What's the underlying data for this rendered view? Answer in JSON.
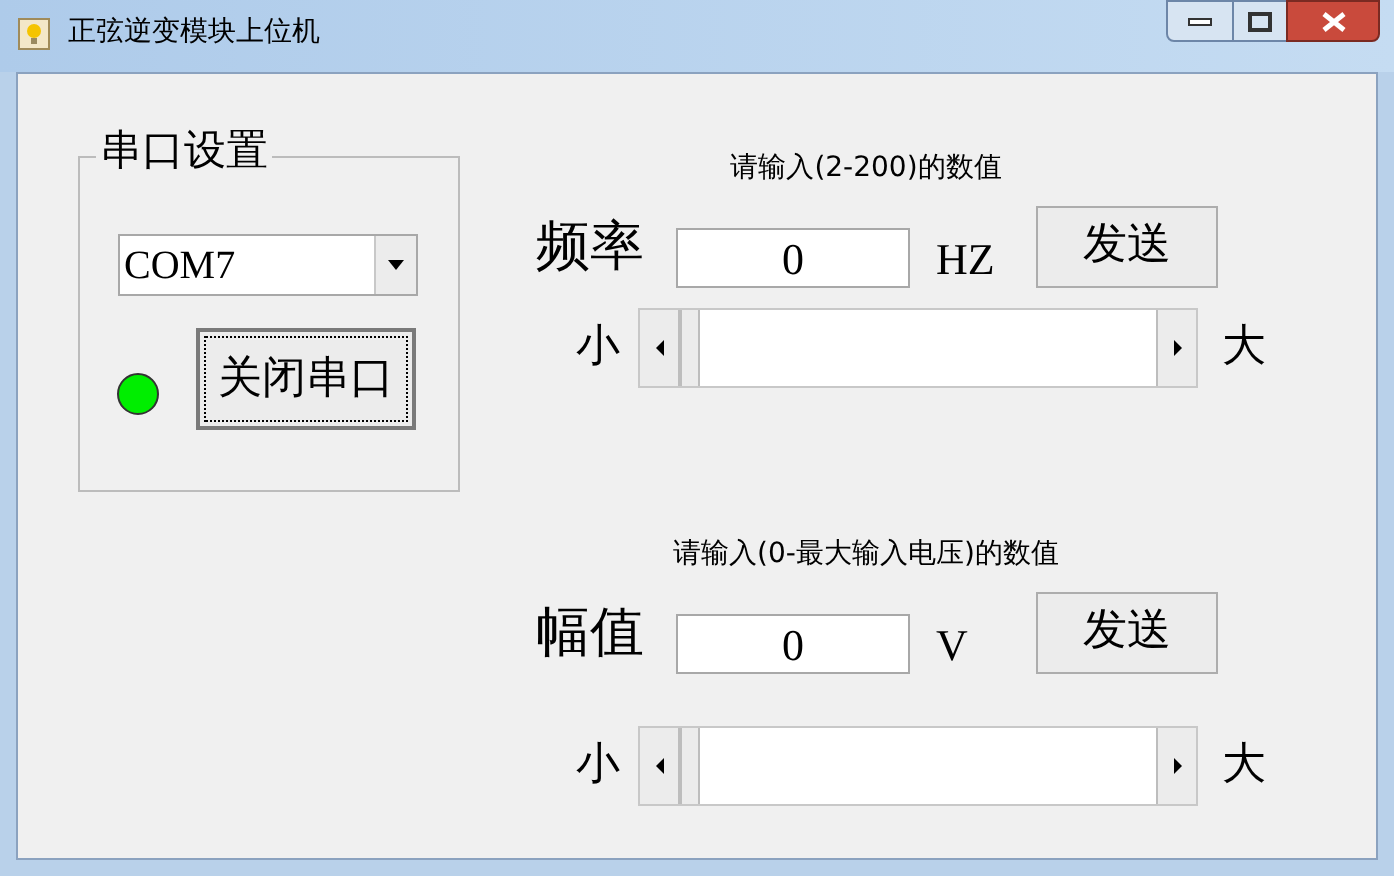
{
  "window": {
    "title": "正弦逆变模块上位机"
  },
  "serial_group": {
    "title": "串口设置",
    "port": "COM7",
    "connected": true,
    "toggle_button": "关闭串口"
  },
  "sections": [
    {
      "hint": "请输入(2-200)的数值",
      "label": "频率",
      "value": "0",
      "unit": "HZ",
      "send_button": "发送",
      "min_label": "小",
      "max_label": "大"
    },
    {
      "hint": "请输入(0-最大输入电压)的数值",
      "label": "幅值",
      "value": "0",
      "unit": "V",
      "send_button": "发送",
      "min_label": "小",
      "max_label": "大"
    }
  ]
}
